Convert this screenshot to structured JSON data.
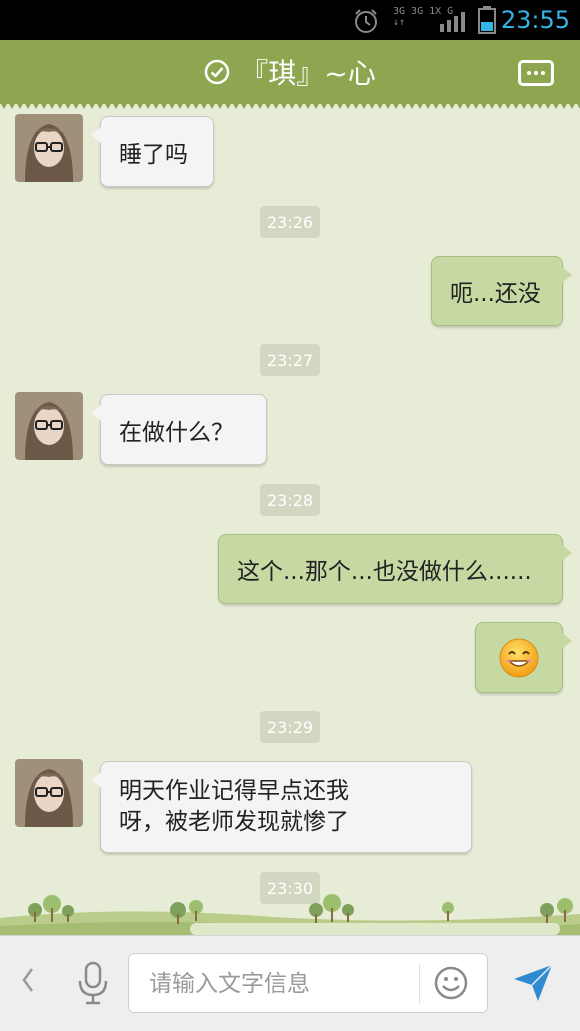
{
  "status_bar": {
    "time": "23:55",
    "network": [
      "3G 3G 1X G",
      "↓↑"
    ]
  },
  "header": {
    "title": "『琪』~心",
    "verified_icon": "check-circle-icon",
    "more_icon": "more-dots-icon"
  },
  "messages": [
    {
      "type": "incoming",
      "text": "睡了吗"
    },
    {
      "type": "timestamp",
      "text": "23:26"
    },
    {
      "type": "outgoing",
      "text": "呃...还没"
    },
    {
      "type": "timestamp",
      "text": "23:27"
    },
    {
      "type": "incoming",
      "text": "在做什么？"
    },
    {
      "type": "timestamp",
      "text": "23:28"
    },
    {
      "type": "outgoing",
      "text": "这个...那个...也没做什么......"
    },
    {
      "type": "outgoing_emoji",
      "emoji": "smiling-face-emoji"
    },
    {
      "type": "timestamp",
      "text": "23:29"
    },
    {
      "type": "incoming",
      "lines": [
        "明天作业记得早点还我",
        "呀，被老师发现就惨了"
      ]
    },
    {
      "type": "timestamp",
      "text": "23:30"
    }
  ],
  "input_bar": {
    "placeholder": "请输入文字信息",
    "back_icon": "chevron-left-icon",
    "mic_icon": "microphone-icon",
    "emoji_icon": "smiley-icon",
    "send_icon": "send-arrow-icon"
  },
  "colors": {
    "header": "#8ea64f",
    "background": "#e6ecd6",
    "outgoing_bubble": "#c6d9a3",
    "incoming_bubble": "#f4f4f4",
    "status_time": "#33b5e5"
  }
}
